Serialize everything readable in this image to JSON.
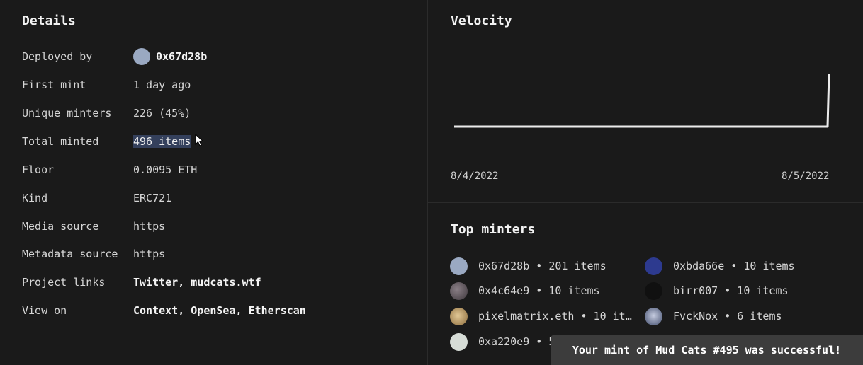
{
  "details": {
    "title": "Details",
    "rows": [
      {
        "label": "Deployed by",
        "value": "0x67d28b",
        "avatar_color": "#9aa9c2"
      },
      {
        "label": "First mint",
        "value": "1 day ago"
      },
      {
        "label": "Unique minters",
        "value": "226 (45%)"
      },
      {
        "label": "Total minted",
        "value": "496 items"
      },
      {
        "label": "Floor",
        "value": "0.0095 ETH"
      },
      {
        "label": "Kind",
        "value": "ERC721"
      },
      {
        "label": "Media source",
        "value": "https"
      },
      {
        "label": "Metadata source",
        "value": "https"
      },
      {
        "label": "Project links",
        "links": [
          "Twitter",
          "mudcats.wtf"
        ]
      },
      {
        "label": "View on",
        "links": [
          "Context",
          "OpenSea",
          "Etherscan"
        ]
      }
    ]
  },
  "velocity": {
    "title": "Velocity",
    "x_start": "8/4/2022",
    "x_end": "8/5/2022"
  },
  "chart_data": {
    "type": "line",
    "x": [
      "8/4/2022",
      "8/5/2022"
    ],
    "series": [
      {
        "values": [
          0,
          0,
          1
        ]
      }
    ]
  },
  "top_minters": {
    "title": "Top minters",
    "items": [
      {
        "text": "0x67d28b • 201 items",
        "avatar_color": "#9aa9c2"
      },
      {
        "text": "0xbda66e • 10 items",
        "avatar_color": "#2d3a8f"
      },
      {
        "text": "0x4c64e9 • 10 items",
        "avatar_color": "#5a5258"
      },
      {
        "text": "birr007 • 10 items",
        "avatar_color": "#101010"
      },
      {
        "text": "pixelmatrix.eth • 10 it…",
        "avatar_color": "#b89a6a"
      },
      {
        "text": "FvckNox • 6 items",
        "avatar_color": "#5a6680"
      },
      {
        "text": "0xa220e9 • 5",
        "avatar_color": "#d6dcd6"
      }
    ]
  },
  "toast": {
    "message": "Your mint of Mud Cats #495 was successful!"
  },
  "colors": {
    "background": "#181818",
    "panel": "#1a1a1a",
    "highlight": "#34405c",
    "toast": "#3c3c3c"
  }
}
